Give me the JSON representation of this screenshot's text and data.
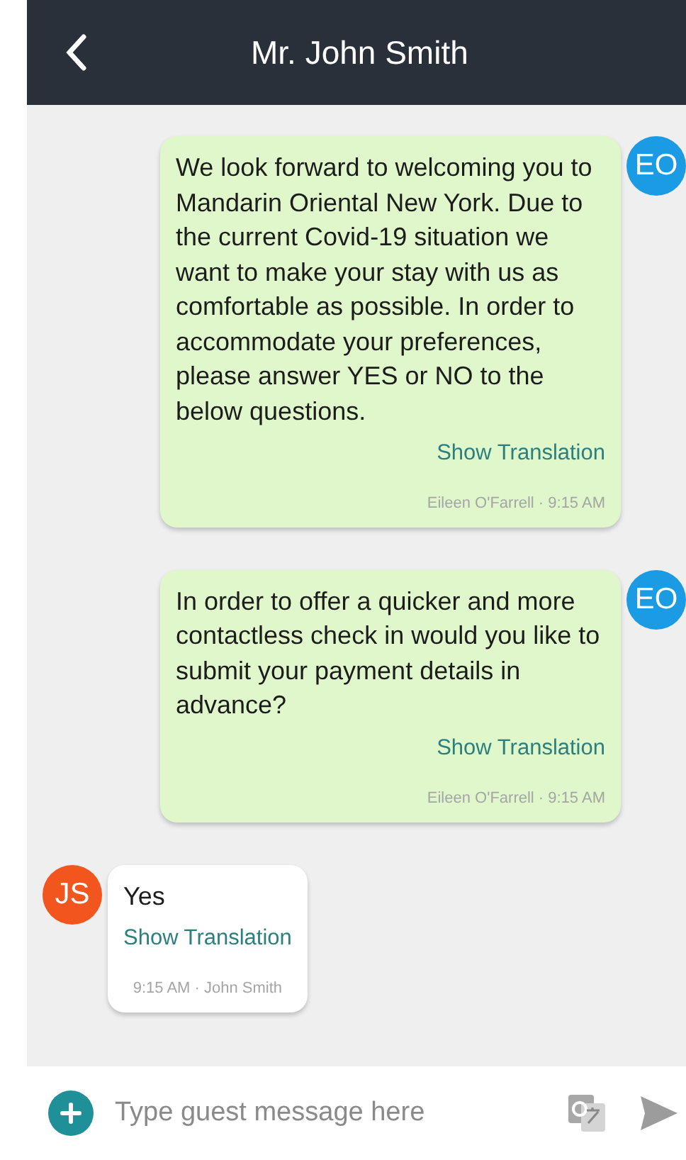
{
  "header": {
    "title": "Mr. John Smith"
  },
  "messages": [
    {
      "kind": "staff",
      "avatar": "EO",
      "text": "We look forward to welcoming you to Mandarin Oriental New York. Due to the current Covid-19 situation we want to make your stay with us as comfortable as possible. In order to accommodate your preferences, please answer YES or NO to the below questions.",
      "link": "Show Translation",
      "meta": "Eileen O'Farrell · 9:15 AM"
    },
    {
      "kind": "staff",
      "avatar": "EO",
      "text": "In order to offer a quicker and more contactless check in would you like to submit your payment details in advance?",
      "link": "Show Translation",
      "meta": "Eileen O'Farrell · 9:15 AM"
    },
    {
      "kind": "guest",
      "avatar": "JS",
      "text": "Yes",
      "link": "Show Translation",
      "meta": "9:15 AM · John Smith"
    }
  ],
  "composer": {
    "placeholder": "Type guest message here"
  }
}
